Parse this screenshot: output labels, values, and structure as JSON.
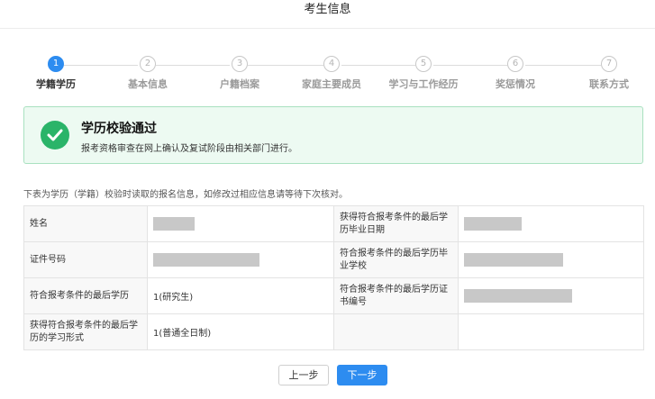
{
  "header": {
    "title": "考生信息"
  },
  "steps": [
    {
      "num": "1",
      "label": "学籍学历",
      "active": true
    },
    {
      "num": "2",
      "label": "基本信息",
      "active": false
    },
    {
      "num": "3",
      "label": "户籍档案",
      "active": false
    },
    {
      "num": "4",
      "label": "家庭主要成员",
      "active": false
    },
    {
      "num": "5",
      "label": "学习与工作经历",
      "active": false
    },
    {
      "num": "6",
      "label": "奖惩情况",
      "active": false
    },
    {
      "num": "7",
      "label": "联系方式",
      "active": false
    }
  ],
  "alert": {
    "title": "学历校验通过",
    "description": "报考资格审查在网上确认及复试阶段由相关部门进行。",
    "icon": "check-circle-icon",
    "color": "#2ab469"
  },
  "note": "下表为学历（学籍）校验时读取的报名信息，如修改过相应信息请等待下次核对。",
  "table": {
    "rows": [
      {
        "l1": "姓名",
        "v1": "",
        "l2": "获得符合报考条件的最后学历毕业日期",
        "v2": ""
      },
      {
        "l1": "证件号码",
        "v1": "",
        "l2": "符合报考条件的最后学历毕业学校",
        "v2": ""
      },
      {
        "l1": "符合报考条件的最后学历",
        "v1": "1(研究生)",
        "l2": "符合报考条件的最后学历证书编号",
        "v2": ""
      },
      {
        "l1": "获得符合报考条件的最后学历的学习形式",
        "v1": "1(普通全日制)",
        "l2": "",
        "v2": ""
      }
    ]
  },
  "buttons": {
    "prev": "上一步",
    "next": "下一步"
  },
  "colors": {
    "primary": "#2d8cf0",
    "success": "#2ab469"
  }
}
